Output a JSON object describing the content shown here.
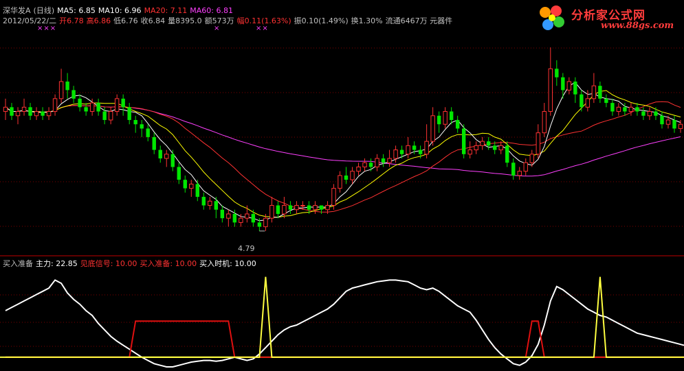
{
  "header": {
    "stock_name": "深华发A",
    "period": "(日线)",
    "ma5": "MA5: 6.85",
    "ma10": "MA10: 6.96",
    "ma20": "MA20: 7.11",
    "ma60": "MA60: 6.81",
    "date": "2012/05/22/二",
    "open": "开6.78",
    "high": "高6.86",
    "low": "低6.76",
    "close": "收6.84",
    "volume": "量8395.0",
    "amount": "额573万",
    "change": "幅0.11(1.63%)",
    "amplitude": "振0.10(1.49%)",
    "turnover": "换1.30%",
    "float": "流通6467万 元器件"
  },
  "marks": {
    "m1": "×××",
    "m2": "×",
    "m3": "××"
  },
  "logo": {
    "title": "分析家公式网",
    "url": "www.88gs.com"
  },
  "indicator": {
    "name": "买入准备",
    "main": "主力: 22.85",
    "signal1": "见底信号: 10.00",
    "signal2": "买入准备: 10.00",
    "signal3": "买入时机: 10.00"
  },
  "colors": {
    "up": "#ff3232",
    "down": "#00e600",
    "ma5": "#ffffff",
    "ma10": "#ffff00",
    "ma20": "#ff3232",
    "ma60": "#ff40ff",
    "grid": "#800000",
    "axis": "#c00000",
    "zhuli": "#ffffff",
    "zhunbei": "#e01010",
    "shiji": "#ffff40"
  },
  "chart_data": [
    {
      "type": "candlestick",
      "ylim": [
        4.3,
        9.6
      ],
      "low_annotation": "4.79",
      "candles": [
        [
          7.6,
          7.7,
          7.9,
          7.4
        ],
        [
          7.7,
          7.5,
          7.8,
          7.4
        ],
        [
          7.5,
          7.6,
          7.7,
          7.3
        ],
        [
          7.6,
          7.7,
          7.9,
          7.5
        ],
        [
          7.7,
          7.5,
          7.8,
          7.4
        ],
        [
          7.5,
          7.6,
          7.7,
          7.4
        ],
        [
          7.6,
          7.5,
          7.7,
          7.4
        ],
        [
          7.5,
          7.6,
          7.7,
          7.4
        ],
        [
          7.6,
          7.9,
          8.0,
          7.5
        ],
        [
          7.9,
          8.3,
          8.6,
          7.8
        ],
        [
          8.3,
          8.1,
          8.5,
          7.9
        ],
        [
          8.1,
          7.9,
          8.2,
          7.8
        ],
        [
          7.9,
          7.7,
          8.0,
          7.6
        ],
        [
          7.7,
          7.6,
          7.8,
          7.5
        ],
        [
          7.6,
          7.8,
          7.9,
          7.5
        ],
        [
          7.8,
          7.6,
          7.9,
          7.5
        ],
        [
          7.6,
          7.4,
          7.7,
          7.3
        ],
        [
          7.4,
          7.6,
          7.7,
          7.3
        ],
        [
          7.6,
          7.9,
          8.0,
          7.5
        ],
        [
          7.9,
          7.7,
          8.0,
          7.5
        ],
        [
          7.7,
          7.4,
          7.8,
          7.3
        ],
        [
          7.4,
          7.3,
          7.5,
          7.1
        ],
        [
          7.3,
          7.2,
          7.4,
          7.0
        ],
        [
          7.2,
          7.0,
          7.3,
          6.9
        ],
        [
          7.0,
          6.7,
          7.1,
          6.6
        ],
        [
          6.7,
          6.5,
          6.8,
          6.4
        ],
        [
          6.5,
          6.6,
          6.7,
          6.3
        ],
        [
          6.6,
          6.3,
          6.7,
          6.2
        ],
        [
          6.3,
          6.0,
          6.4,
          5.9
        ],
        [
          6.0,
          5.8,
          6.1,
          5.7
        ],
        [
          5.8,
          5.9,
          6.0,
          5.6
        ],
        [
          5.9,
          5.6,
          6.0,
          5.5
        ],
        [
          5.6,
          5.4,
          5.7,
          5.3
        ],
        [
          5.4,
          5.5,
          5.6,
          5.3
        ],
        [
          5.5,
          5.3,
          5.6,
          5.1
        ],
        [
          5.3,
          5.1,
          5.4,
          5.0
        ],
        [
          5.1,
          5.2,
          5.3,
          4.9
        ],
        [
          5.2,
          5.0,
          5.3,
          4.9
        ],
        [
          5.0,
          5.1,
          5.2,
          4.9
        ],
        [
          5.1,
          5.2,
          5.4,
          5.0
        ],
        [
          5.2,
          5.0,
          5.3,
          4.9
        ],
        [
          5.0,
          4.9,
          5.1,
          4.8
        ],
        [
          4.9,
          5.1,
          5.2,
          4.8
        ],
        [
          5.1,
          5.4,
          5.6,
          5.0
        ],
        [
          5.4,
          5.2,
          5.5,
          5.1
        ],
        [
          5.2,
          5.4,
          5.6,
          5.1
        ],
        [
          5.4,
          5.3,
          5.5,
          5.2
        ],
        [
          5.3,
          5.4,
          5.5,
          5.2
        ],
        [
          5.4,
          5.4,
          5.5,
          5.3
        ],
        [
          5.4,
          5.3,
          5.5,
          5.2
        ],
        [
          5.3,
          5.4,
          5.5,
          5.2
        ],
        [
          5.4,
          5.3,
          5.4,
          5.2
        ],
        [
          5.3,
          5.4,
          5.5,
          5.2
        ],
        [
          5.4,
          5.8,
          5.9,
          5.3
        ],
        [
          5.8,
          6.1,
          6.2,
          5.7
        ],
        [
          6.1,
          6.0,
          6.3,
          5.9
        ],
        [
          6.0,
          6.2,
          6.3,
          5.9
        ],
        [
          6.2,
          6.3,
          6.4,
          6.1
        ],
        [
          6.3,
          6.4,
          6.5,
          6.2
        ],
        [
          6.4,
          6.3,
          6.5,
          6.2
        ],
        [
          6.3,
          6.5,
          6.6,
          6.2
        ],
        [
          6.5,
          6.4,
          6.6,
          6.3
        ],
        [
          6.4,
          6.5,
          6.7,
          6.3
        ],
        [
          6.5,
          6.7,
          6.8,
          6.4
        ],
        [
          6.7,
          6.6,
          6.8,
          6.5
        ],
        [
          6.6,
          6.8,
          7.0,
          6.5
        ],
        [
          6.8,
          6.7,
          6.9,
          6.6
        ],
        [
          6.7,
          6.6,
          6.8,
          6.5
        ],
        [
          6.6,
          6.9,
          7.3,
          6.5
        ],
        [
          6.9,
          7.5,
          7.7,
          6.8
        ],
        [
          7.5,
          7.3,
          7.6,
          7.1
        ],
        [
          7.3,
          7.6,
          7.7,
          7.2
        ],
        [
          7.6,
          7.4,
          7.7,
          7.3
        ],
        [
          7.4,
          7.2,
          7.5,
          7.1
        ],
        [
          7.2,
          6.6,
          7.3,
          6.5
        ],
        [
          6.6,
          6.7,
          6.9,
          6.5
        ],
        [
          6.7,
          6.8,
          6.9,
          6.6
        ],
        [
          6.8,
          6.9,
          7.0,
          6.7
        ],
        [
          6.9,
          6.8,
          7.0,
          6.7
        ],
        [
          6.8,
          6.7,
          6.9,
          6.6
        ],
        [
          6.7,
          6.8,
          6.9,
          6.6
        ],
        [
          6.8,
          6.4,
          6.9,
          6.3
        ],
        [
          6.4,
          6.1,
          6.5,
          6.0
        ],
        [
          6.1,
          6.2,
          6.3,
          6.0
        ],
        [
          6.2,
          6.4,
          6.5,
          6.1
        ],
        [
          6.4,
          6.6,
          6.7,
          6.3
        ],
        [
          6.6,
          7.1,
          7.3,
          6.5
        ],
        [
          7.1,
          7.6,
          7.8,
          7.0
        ],
        [
          7.6,
          8.6,
          9.1,
          7.5
        ],
        [
          8.6,
          8.4,
          8.8,
          8.2
        ],
        [
          8.4,
          8.1,
          8.5,
          7.9
        ],
        [
          8.1,
          8.3,
          8.4,
          8.0
        ],
        [
          8.3,
          8.0,
          8.4,
          7.8
        ],
        [
          8.0,
          7.7,
          8.1,
          7.6
        ],
        [
          7.7,
          7.9,
          8.1,
          7.6
        ],
        [
          7.9,
          8.2,
          8.5,
          7.8
        ],
        [
          8.2,
          7.9,
          8.3,
          7.8
        ],
        [
          7.9,
          7.8,
          8.0,
          7.7
        ],
        [
          7.8,
          7.6,
          7.9,
          7.5
        ],
        [
          7.6,
          7.7,
          7.8,
          7.5
        ],
        [
          7.7,
          7.6,
          7.8,
          7.5
        ],
        [
          7.6,
          7.7,
          7.8,
          7.5
        ],
        [
          7.7,
          7.6,
          7.8,
          7.5
        ],
        [
          7.6,
          7.5,
          7.7,
          7.4
        ],
        [
          7.5,
          7.6,
          7.7,
          7.4
        ],
        [
          7.6,
          7.5,
          7.7,
          7.4
        ],
        [
          7.5,
          7.3,
          7.6,
          7.2
        ],
        [
          7.3,
          7.4,
          7.5,
          7.2
        ],
        [
          7.4,
          7.2,
          7.5,
          7.1
        ],
        [
          7.2,
          7.3,
          7.4,
          7.1
        ]
      ]
    },
    {
      "type": "line",
      "title": "买入准备",
      "ylim": [
        -12,
        110
      ],
      "series": [
        {
          "name": "主力",
          "values": [
            58,
            62,
            66,
            70,
            74,
            78,
            82,
            86,
            96,
            92,
            80,
            72,
            66,
            58,
            52,
            42,
            34,
            26,
            20,
            15,
            10,
            5,
            0,
            -4,
            -8,
            -10,
            -12,
            -12,
            -10,
            -8,
            -6,
            -5,
            -4,
            -4,
            -5,
            -4,
            -2,
            0,
            -2,
            -4,
            -2,
            4,
            12,
            20,
            28,
            34,
            38,
            40,
            44,
            48,
            52,
            56,
            60,
            66,
            74,
            82,
            86,
            88,
            90,
            92,
            94,
            95,
            96,
            96,
            95,
            94,
            90,
            86,
            84,
            86,
            82,
            76,
            70,
            64,
            60,
            56,
            46,
            34,
            22,
            12,
            4,
            -2,
            -8,
            -10,
            -6,
            2,
            16,
            40,
            70,
            88,
            84,
            78,
            72,
            66,
            60,
            56,
            52,
            50,
            46,
            42,
            38,
            34,
            30,
            28,
            26,
            24,
            22,
            20,
            18,
            16,
            14,
            12
          ]
        },
        {
          "name": "见底信号",
          "values": []
        },
        {
          "name": "买入准备",
          "values": [
            0,
            0,
            0,
            0,
            0,
            0,
            0,
            0,
            0,
            0,
            0,
            0,
            0,
            0,
            0,
            0,
            0,
            0,
            0,
            0,
            0,
            45,
            45,
            45,
            45,
            45,
            45,
            45,
            45,
            45,
            45,
            45,
            45,
            45,
            45,
            45,
            45,
            0,
            0,
            0,
            0,
            0,
            0,
            0,
            0,
            0,
            0,
            0,
            0,
            0,
            0,
            0,
            0,
            0,
            0,
            0,
            0,
            0,
            0,
            0,
            0,
            0,
            0,
            0,
            0,
            0,
            0,
            0,
            0,
            0,
            0,
            0,
            0,
            0,
            0,
            0,
            0,
            0,
            0,
            0,
            0,
            0,
            0,
            0,
            0,
            45,
            45,
            0,
            0,
            0,
            0,
            0,
            0,
            0,
            0,
            0,
            0,
            0,
            0,
            0,
            0,
            0,
            0,
            0,
            0,
            0,
            0,
            0,
            0,
            0,
            0,
            0,
            0,
            0
          ]
        },
        {
          "name": "买入时机",
          "values": [
            0,
            0,
            0,
            0,
            0,
            0,
            0,
            0,
            0,
            0,
            0,
            0,
            0,
            0,
            0,
            0,
            0,
            0,
            0,
            0,
            0,
            0,
            0,
            0,
            0,
            0,
            0,
            0,
            0,
            0,
            0,
            0,
            0,
            0,
            0,
            0,
            0,
            0,
            0,
            0,
            0,
            0,
            100,
            0,
            0,
            0,
            0,
            0,
            0,
            0,
            0,
            0,
            0,
            0,
            0,
            0,
            0,
            0,
            0,
            0,
            0,
            0,
            0,
            0,
            0,
            0,
            0,
            0,
            0,
            0,
            0,
            0,
            0,
            0,
            0,
            0,
            0,
            0,
            0,
            0,
            0,
            0,
            0,
            0,
            0,
            0,
            0,
            0,
            0,
            0,
            0,
            0,
            0,
            0,
            0,
            0,
            100,
            0,
            0,
            0,
            0,
            0,
            0,
            0,
            0,
            0,
            0,
            0,
            0,
            0,
            0,
            0
          ]
        }
      ]
    }
  ]
}
